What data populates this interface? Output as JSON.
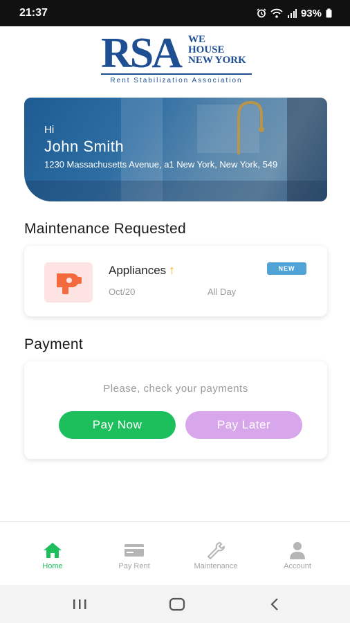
{
  "status_bar": {
    "time": "21:37",
    "battery": "93%",
    "icons": [
      "alarm-icon",
      "wifi-icon",
      "signal-icon",
      "battery-icon"
    ]
  },
  "logo": {
    "letters": "RSA",
    "tagline": [
      "WE",
      "HOUSE",
      "NEW YORK"
    ],
    "subtitle": "Rent Stabilization Association"
  },
  "hero": {
    "greeting": "Hi",
    "name": "John Smith",
    "address": "1230 Massachusetts Avenue, a1 New York, New York, 549"
  },
  "maintenance": {
    "section_title": "Maintenance Requested",
    "item": {
      "icon": "hair-dryer-icon",
      "title": "Appliances",
      "priority_icon": "arrow-up-icon",
      "date": "Oct/20",
      "time": "All Day",
      "badge": "NEW"
    }
  },
  "payment": {
    "section_title": "Payment",
    "message": "Please, check your payments",
    "pay_now_label": "Pay Now",
    "pay_later_label": "Pay Later"
  },
  "bottom_nav": {
    "items": [
      {
        "label": "Home",
        "icon": "home-icon",
        "active": true
      },
      {
        "label": "Pay Rent",
        "icon": "credit-card-icon",
        "active": false
      },
      {
        "label": "Maintenance",
        "icon": "wrench-icon",
        "active": false
      },
      {
        "label": "Account",
        "icon": "user-icon",
        "active": false
      }
    ]
  },
  "colors": {
    "accent_green": "#1dbf5d",
    "pay_later_purple": "#d8a6ea",
    "brand_blue": "#1f4f93",
    "badge_blue": "#4fa3d6",
    "priority_yellow": "#f2b21a",
    "appliance_orange": "#f26a3d"
  }
}
